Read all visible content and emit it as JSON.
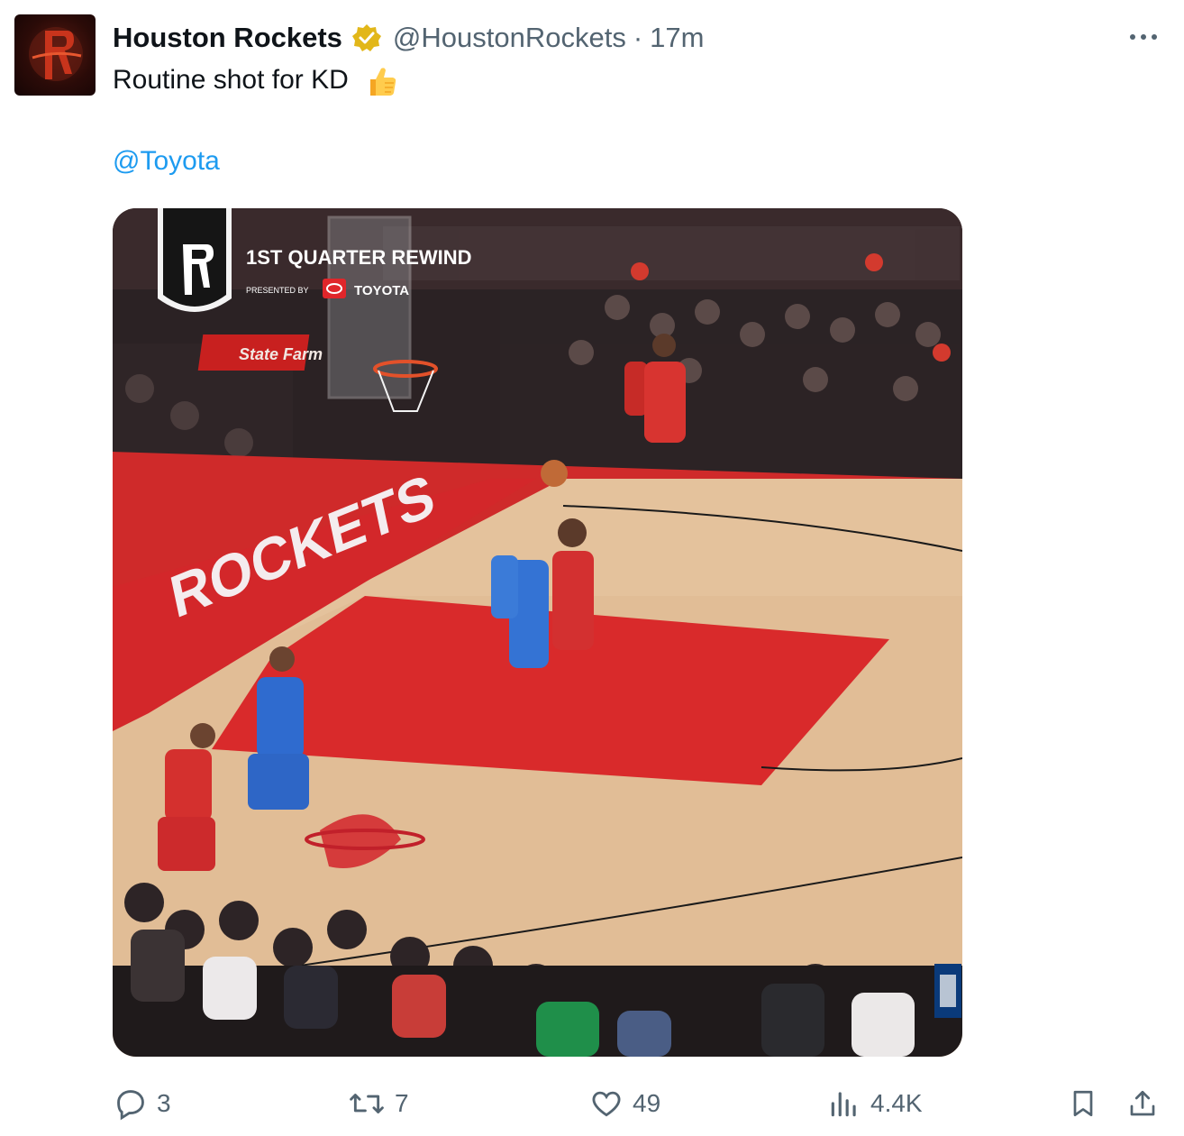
{
  "post": {
    "display_name": "Houston Rockets",
    "handle": "@HoustonRockets",
    "separator": "·",
    "timestamp": "17m",
    "text": "Routine shot for KD",
    "mention": "@Toyota",
    "verified": true
  },
  "media": {
    "overlay_title": "1ST QUARTER REWIND",
    "overlay_presented_by": "PRESENTED BY",
    "overlay_sponsor": "TOYOTA",
    "court_text": "ROCKETS",
    "sign_text": "State Farm"
  },
  "actions": {
    "replies": "3",
    "reposts": "7",
    "likes": "49",
    "views": "4.4K"
  },
  "colors": {
    "rockets_red": "#ce1141",
    "link_blue": "#1d9bf0",
    "muted_text": "#536471",
    "verified_gold": "#e2b719"
  },
  "icons": [
    "rockets-logo-icon",
    "verified-badge-icon",
    "more-options-icon",
    "thumbs-up-emoji",
    "reply-icon",
    "repost-icon",
    "like-icon",
    "views-icon",
    "bookmark-icon",
    "share-icon"
  ]
}
